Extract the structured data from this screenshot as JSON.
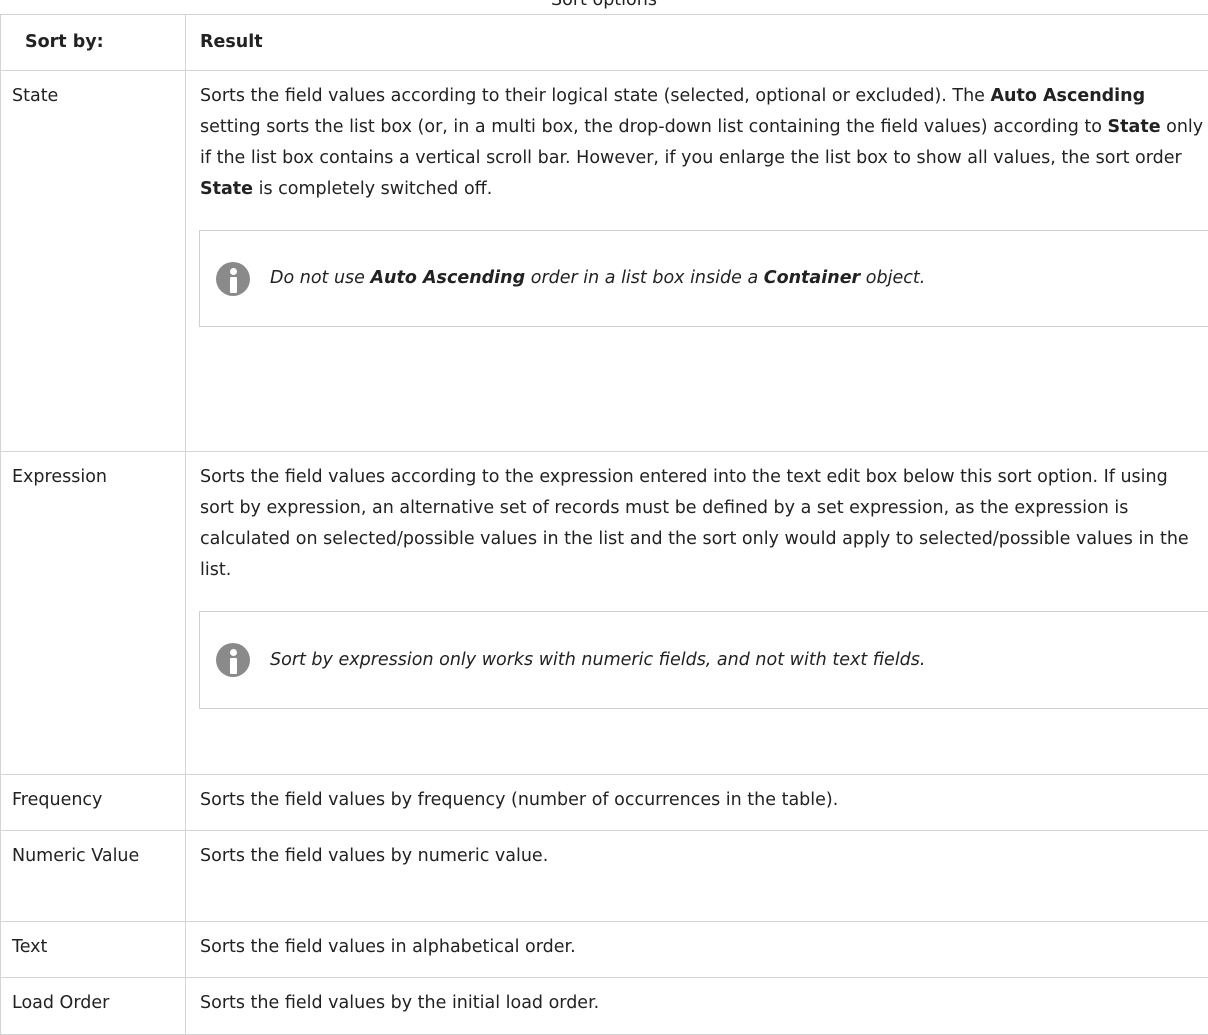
{
  "caption": "Sort options",
  "table": {
    "headers": [
      "Sort by:",
      "Result"
    ],
    "rows": [
      {
        "label": "State",
        "text_parts": [
          "Sorts the field values according to their logical state (selected, optional or excluded). The ",
          "Auto Ascending",
          " setting sorts the list box (or, in a multi box, the drop-down list containing the field values) according to ",
          "State",
          " only if the list box contains a vertical scroll bar. However, if you enlarge the list box to show all values, the sort order ",
          "State",
          " is completely switched off."
        ],
        "note_parts": [
          "Do not use ",
          "Auto Ascending",
          " order in a list box inside a ",
          "Container",
          " object."
        ]
      },
      {
        "label": "Expression",
        "text": "Sorts the field values according to the expression entered into the text edit box below this sort option. If using sort by expression, an alternative set of records must be defined by a set expression, as the expression is calculated on selected/possible values in the list and the sort only would apply to selected/possible values in the list.",
        "note": "Sort by expression only works with numeric fields, and not with text fields."
      },
      {
        "label": "Frequency",
        "text": "Sorts the field values by frequency (number of occurrences in the table)."
      },
      {
        "label": "Numeric Value",
        "text": "Sorts the field values by numeric value."
      },
      {
        "label": "Text",
        "text": "Sorts the field values in alphabetical order."
      },
      {
        "label": "Load Order",
        "text": "Sorts the field values by the initial load order."
      }
    ]
  },
  "icons": {
    "note_icon": "info-icon"
  },
  "colors": {
    "border": "#d4d4d4",
    "text": "#222222",
    "icon": "#8a8a8a"
  }
}
